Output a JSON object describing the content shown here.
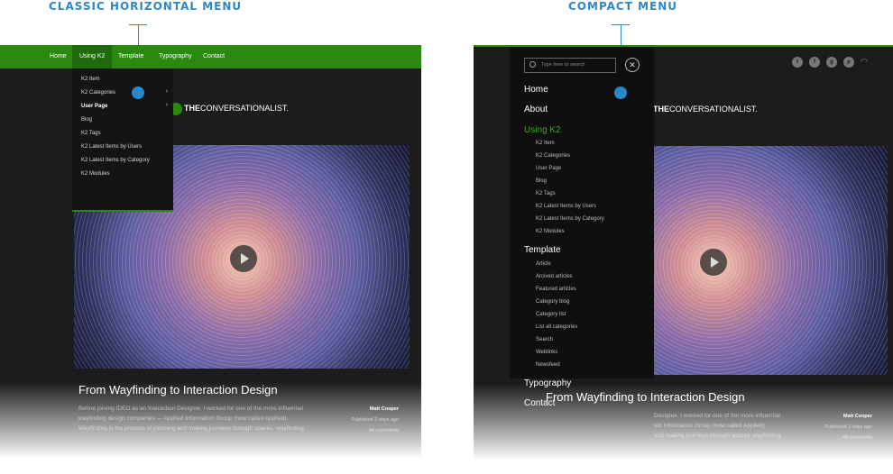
{
  "captions": {
    "classic": "CLASSIC HORIZONTAL MENU",
    "compact": "COMPACT MENU"
  },
  "colors": {
    "accent": "#2a87c8",
    "brand_green": "#2a8a0f",
    "background": "#1c1c1c"
  },
  "classic": {
    "nav": [
      "Home",
      "Using K2",
      "Template",
      "Typography",
      "Contact"
    ],
    "active_nav": "Using K2",
    "dropdown": [
      "K2 Item",
      "K2 Categories",
      "User Page",
      "Blog",
      "K2 Tags",
      "K2 Latest Items by Users",
      "K2 Latest Items by Category",
      "K2 Modules"
    ],
    "logo": {
      "bold": "THE",
      "rest": "CONVERSATIONALIST."
    },
    "article": {
      "title": "From Wayfinding to Interaction Design",
      "excerpt": [
        "Before joining IDEO as an Interaction Designer, I worked for one of the more influential",
        "wayfinding design companies — Applied Information Group (now called Applied).",
        "Wayfinding is the process of planning and making journeys through spaces. wayfinding"
      ],
      "author": "Matt Cooper",
      "published": "Published 2 days ago",
      "comments": "44 comments"
    }
  },
  "compact": {
    "search_placeholder": "Type here to search",
    "menu": [
      {
        "label": "Home"
      },
      {
        "label": "About"
      },
      {
        "label": "Using K2",
        "active": true,
        "children": [
          "K2 Item",
          "K2 Categories",
          "User Page",
          "Blog",
          "K2 Tags",
          "K2 Latest Items by Users",
          "K2 Latest Items by Category",
          "K2 Modules"
        ]
      },
      {
        "label": "Template",
        "children": [
          "Article",
          "Arcived articles",
          "Featured articles",
          "Category blog",
          "Category list",
          "List all categories",
          "Search",
          "Weblinks",
          "Newsfeed"
        ]
      },
      {
        "label": "Typography"
      },
      {
        "label": "Contact"
      }
    ],
    "social_icons": [
      "twitter-icon",
      "facebook-icon",
      "google-plus-icon",
      "pinterest-icon",
      "rss-icon"
    ],
    "logo": {
      "bold": "THE",
      "rest": "CONVERSATIONALIST."
    },
    "article": {
      "title": "From Wayfinding to Interaction Design",
      "excerpt": [
        "Designer, I worked for one of the more influential",
        "ied Information Group (now called Applied).",
        "and making journeys through spaces. wayfinding"
      ],
      "author": "Matt Cooper",
      "published": "Published 2 days ago",
      "comments": "44 comments"
    }
  }
}
